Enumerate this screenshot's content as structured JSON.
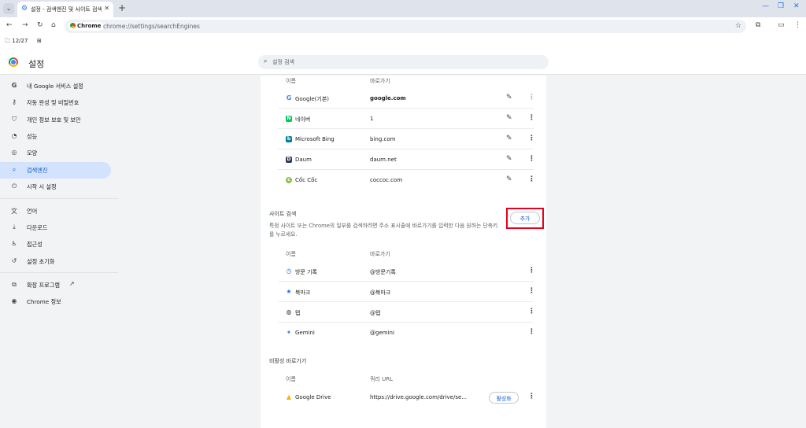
{
  "browser": {
    "tab_title": "설정 - 검색엔진 및 사이트 검색",
    "site_chip": "Chrome",
    "url": "chrome://settings/searchEngines",
    "bookmark_folder": "12/27"
  },
  "header": {
    "title": "설정",
    "search_placeholder": "설정 검색"
  },
  "sidebar": {
    "items": [
      {
        "label": "내 Google 서비스 설정",
        "icon": "google-g-icon"
      },
      {
        "label": "자동 완성 및 비밀번호",
        "icon": "key-icon"
      },
      {
        "label": "개인 정보 보호 및 보안",
        "icon": "shield-icon"
      },
      {
        "label": "성능",
        "icon": "speedometer-icon"
      },
      {
        "label": "모양",
        "icon": "palette-icon"
      },
      {
        "label": "검색엔진",
        "icon": "search-icon",
        "active": true
      },
      {
        "label": "시작 시 설정",
        "icon": "power-icon"
      },
      {
        "label": "언어",
        "icon": "translate-icon"
      },
      {
        "label": "다운로드",
        "icon": "download-icon"
      },
      {
        "label": "접근성",
        "icon": "accessibility-icon"
      },
      {
        "label": "설정 초기화",
        "icon": "reset-icon"
      },
      {
        "label": "확장 프로그램",
        "icon": "puzzle-icon"
      },
      {
        "label": "Chrome 정보",
        "icon": "chrome-icon"
      }
    ]
  },
  "search_engines": {
    "col_name": "이름",
    "col_shortcut": "바로가기",
    "rows": [
      {
        "name": "Google(기본)",
        "shortcut": "google.com"
      },
      {
        "name": "네이버",
        "shortcut": "1"
      },
      {
        "name": "Microsoft Bing",
        "shortcut": "bing.com"
      },
      {
        "name": "Daum",
        "shortcut": "daum.net"
      },
      {
        "name": "Cốc Cốc",
        "shortcut": "coccoc.com"
      }
    ]
  },
  "site_search": {
    "title": "사이트 검색",
    "description": "특정 사이트 또는 Chrome의 일부를 검색하려면 주소 표시줄에 바로가기를 입력한 다음 원하는 단축키를 누르세요.",
    "add_label": "추가",
    "col_name": "이름",
    "col_shortcut": "바로가기",
    "rows": [
      {
        "name": "방문 기록",
        "shortcut": "@방문기록"
      },
      {
        "name": "북마크",
        "shortcut": "@북마크"
      },
      {
        "name": "탭",
        "shortcut": "@탭"
      },
      {
        "name": "Gemini",
        "shortcut": "@gemini"
      }
    ]
  },
  "inactive": {
    "title": "비활성 바로가기",
    "col_name": "이름",
    "col_url": "쿼리 URL",
    "rows": [
      {
        "name": "Google Drive",
        "url": "https://drive.google.com/drive/se...",
        "action": "활성화"
      }
    ]
  },
  "colors": {
    "accent": "#0b57d0",
    "active_nav": "#d3e3fd",
    "highlight": "#e8001c"
  }
}
